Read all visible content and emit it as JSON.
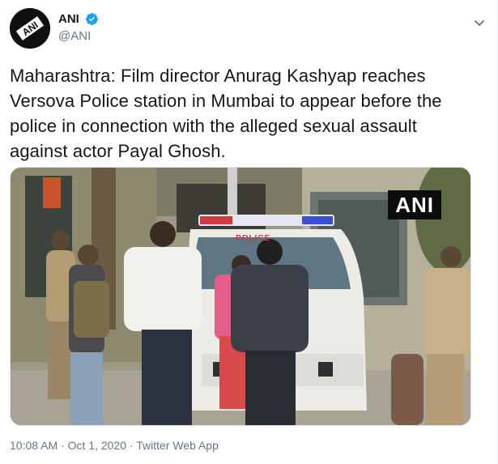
{
  "author": {
    "display_name": "ANI",
    "handle": "@ANI",
    "avatar_text": "ANI",
    "verified": true,
    "avatar_icon": "ani-logo-avatar",
    "verified_icon": "verified-badge-icon",
    "menu_icon": "chevron-down-icon"
  },
  "tweet": {
    "text": "Maharashtra: Film director Anurag Kashyap reaches Versova Police station in Mumbai to appear before the police in connection with the alleged sexual assault against actor Payal Ghosh.",
    "time": "10:08 AM",
    "sep1": " · ",
    "date": "Oct 1, 2020",
    "sep2": " · ",
    "source": "Twitter Web App"
  },
  "media": {
    "watermark": "ANI",
    "vehicle_label": "POLICE"
  },
  "colors": {
    "text": "#14171a",
    "secondary": "#657786",
    "verified": "#1da1f2",
    "border": "#e1e8ed"
  }
}
